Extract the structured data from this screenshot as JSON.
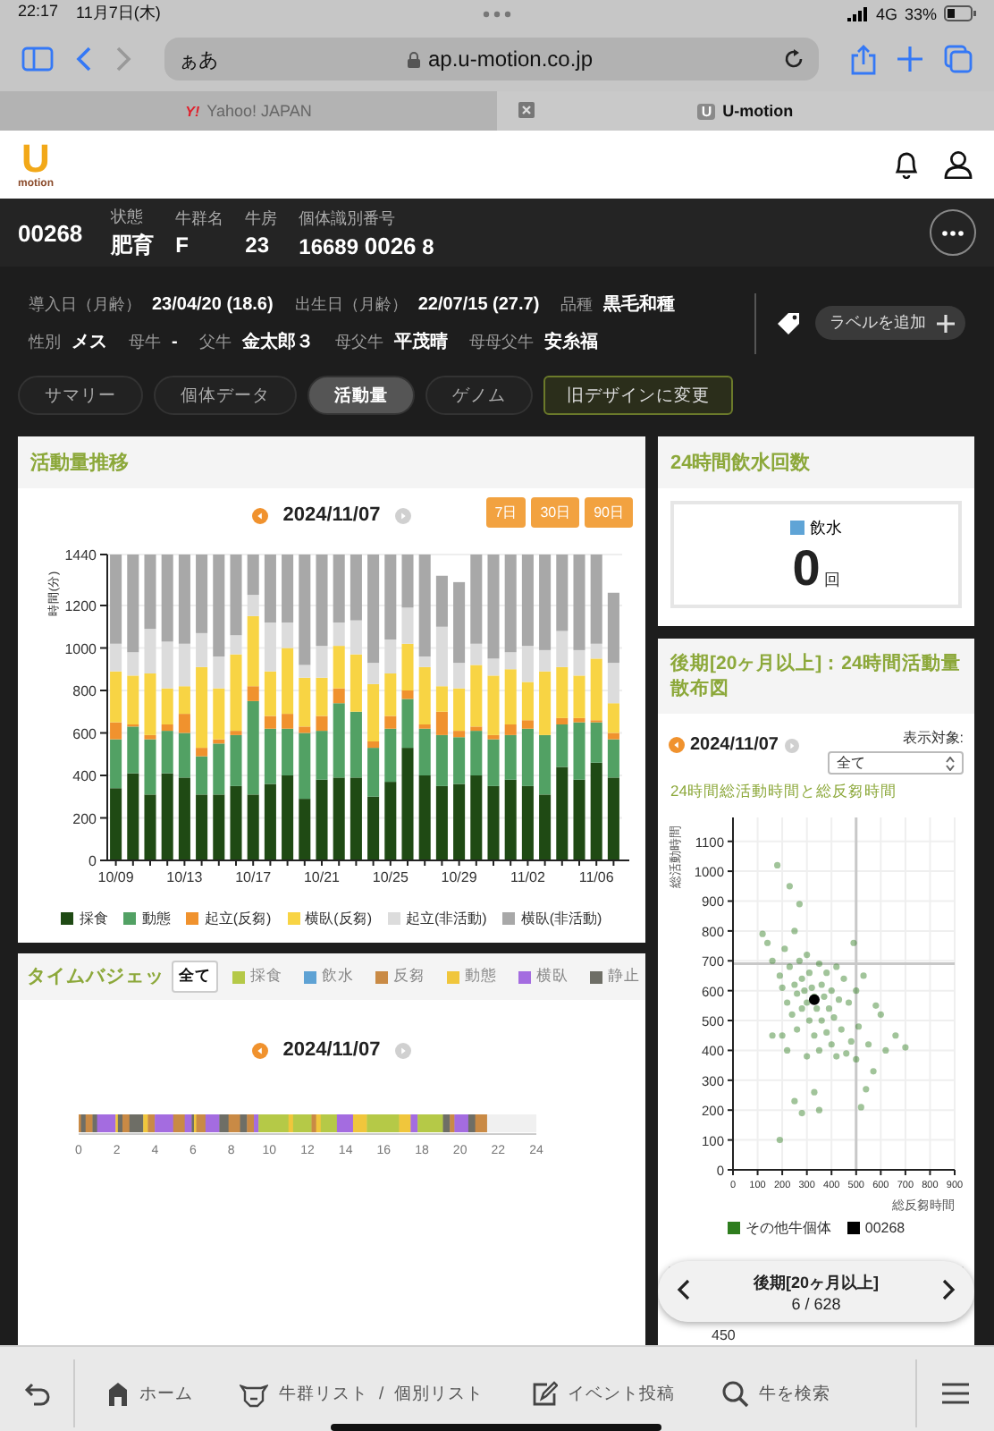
{
  "status_bar": {
    "time": "22:17",
    "date": "11月7日(木)",
    "network": "4G",
    "battery": "33%"
  },
  "browser": {
    "text_size": "ぁあ",
    "url": "ap.u-motion.co.jp",
    "tabs": [
      {
        "favicon": "Y!",
        "title": "Yahoo! JAPAN",
        "selected": false
      },
      {
        "favicon": "U",
        "title": "U-motion",
        "selected": true
      }
    ]
  },
  "logo": {
    "mark": "U",
    "name": "motion"
  },
  "animal": {
    "id": "00268",
    "fields": [
      {
        "label": "状態",
        "value": "肥育"
      },
      {
        "label": "牛群名",
        "value": "F"
      },
      {
        "label": "牛房",
        "value": "23"
      },
      {
        "label": "個体識別番号",
        "value": "16689 **0026** 8"
      }
    ]
  },
  "info_rows": [
    [
      {
        "label": "導入日（月齢）",
        "value": "23/04/20 (18.6)"
      },
      {
        "label": "出生日（月齢）",
        "value": "22/07/15 (27.7)"
      },
      {
        "label": "品種",
        "value": "黒毛和種"
      }
    ],
    [
      {
        "label": "性別",
        "value": "メス"
      },
      {
        "label": "母牛",
        "value": "-"
      },
      {
        "label": "父牛",
        "value": "金太郎３"
      },
      {
        "label": "母父牛",
        "value": "平茂晴"
      },
      {
        "label": "母母父牛",
        "value": "安糸福"
      }
    ]
  ],
  "add_label_button": "ラベルを追加",
  "tabs": [
    {
      "label": "サマリー",
      "selected": false
    },
    {
      "label": "個体データ",
      "selected": false
    },
    {
      "label": "活動量",
      "selected": true
    },
    {
      "label": "ゲノム",
      "selected": false
    }
  ],
  "old_design_button": "旧デザインに変更",
  "activity": {
    "title": "活動量推移",
    "date": "2024/11/07",
    "ranges": [
      "7日",
      "30日",
      "90日"
    ],
    "chart_data": {
      "type": "bar",
      "stacked": true,
      "ylabel": "時間(分)",
      "ylim": [
        0,
        1440
      ],
      "yticks": [
        0,
        200,
        400,
        600,
        800,
        1000,
        1200,
        1440
      ],
      "grid": true,
      "categories": [
        "10/09",
        null,
        null,
        null,
        "10/13",
        null,
        null,
        null,
        "10/17",
        null,
        null,
        null,
        "10/21",
        null,
        null,
        null,
        "10/25",
        null,
        null,
        null,
        "10/29",
        null,
        null,
        null,
        "11/02",
        null,
        null,
        null,
        "11/06",
        null
      ],
      "series": [
        {
          "name": "採食",
          "color": "#1f4a14",
          "values": [
            340,
            410,
            310,
            410,
            390,
            310,
            310,
            350,
            310,
            360,
            400,
            290,
            380,
            390,
            390,
            300,
            370,
            530,
            400,
            350,
            360,
            400,
            350,
            380,
            350,
            310,
            440,
            380,
            460,
            390
          ]
        },
        {
          "name": "動態",
          "color": "#52a164",
          "values": [
            230,
            220,
            260,
            200,
            210,
            180,
            240,
            240,
            440,
            260,
            220,
            310,
            230,
            350,
            310,
            230,
            250,
            230,
            220,
            240,
            220,
            210,
            220,
            210,
            270,
            280,
            200,
            270,
            190,
            180
          ]
        },
        {
          "name": "起立(反芻)",
          "color": "#f0922e",
          "values": [
            80,
            10,
            20,
            30,
            90,
            40,
            20,
            20,
            70,
            60,
            70,
            30,
            70,
            70,
            0,
            30,
            60,
            40,
            20,
            110,
            30,
            20,
            20,
            50,
            40,
            0,
            30,
            20,
            10,
            30
          ]
        },
        {
          "name": "横臥(反芻)",
          "color": "#f8d444",
          "values": [
            240,
            230,
            290,
            170,
            130,
            380,
            240,
            360,
            330,
            210,
            310,
            230,
            180,
            200,
            270,
            270,
            200,
            220,
            270,
            120,
            200,
            290,
            280,
            260,
            180,
            300,
            240,
            200,
            290,
            140
          ]
        },
        {
          "name": "起立(非活動)",
          "color": "#dcdcdc",
          "values": [
            130,
            110,
            210,
            220,
            200,
            160,
            150,
            90,
            100,
            230,
            120,
            60,
            150,
            110,
            160,
            100,
            160,
            170,
            50,
            280,
            120,
            100,
            80,
            80,
            170,
            100,
            170,
            120,
            70,
            190
          ]
        },
        {
          "name": "横臥(非活動)",
          "color": "#a8a8a8",
          "values": [
            420,
            460,
            350,
            410,
            420,
            370,
            480,
            380,
            190,
            320,
            320,
            520,
            430,
            320,
            310,
            510,
            400,
            250,
            480,
            240,
            380,
            420,
            490,
            460,
            430,
            450,
            360,
            450,
            420,
            330
          ]
        }
      ]
    }
  },
  "water": {
    "title": "24時間飲水回数",
    "legend": "飲水",
    "color": "#5fa4d6",
    "value": "0",
    "unit": "回"
  },
  "scatter": {
    "title": "後期[20ヶ月以上]：24時間活動量散布図",
    "date": "2024/11/07",
    "filter_label": "表示対象:",
    "filter_value": "全て",
    "subtitle": "24時間総活動時間と総反芻時間",
    "chart_data": {
      "type": "scatter",
      "xlabel": "総反芻時間",
      "ylabel": "総活動時間",
      "xlim": [
        0,
        900
      ],
      "ylim": [
        0,
        1180
      ],
      "xticks": [
        0,
        100,
        200,
        300,
        400,
        500,
        600,
        700,
        800,
        900
      ],
      "yticks": [
        0,
        100,
        200,
        300,
        400,
        500,
        600,
        700,
        800,
        900,
        1000,
        1100
      ],
      "grid": true,
      "ref_lines": [
        {
          "axis": "y",
          "value": 690
        },
        {
          "axis": "x",
          "value": 500
        }
      ],
      "series": [
        {
          "name": "その他牛個体",
          "color": "#2e7d1e",
          "x": [
            120,
            140,
            160,
            180,
            190,
            200,
            210,
            220,
            230,
            230,
            240,
            250,
            250,
            260,
            260,
            270,
            270,
            280,
            280,
            290,
            300,
            300,
            310,
            310,
            320,
            330,
            330,
            340,
            350,
            350,
            360,
            360,
            370,
            380,
            380,
            390,
            400,
            400,
            410,
            420,
            420,
            430,
            440,
            450,
            460,
            470,
            480,
            490,
            500,
            500,
            510,
            520,
            530,
            540,
            550,
            570,
            580,
            600,
            620,
            660,
            700,
            250,
            280,
            350,
            190,
            200,
            160,
            220,
            300,
            330
          ],
          "values": [
            790,
            760,
            700,
            1020,
            650,
            610,
            740,
            560,
            950,
            680,
            520,
            800,
            620,
            590,
            470,
            890,
            700,
            540,
            640,
            600,
            560,
            720,
            500,
            660,
            610,
            580,
            450,
            540,
            690,
            400,
            620,
            500,
            580,
            660,
            460,
            540,
            600,
            420,
            510,
            680,
            380,
            570,
            470,
            640,
            390,
            560,
            430,
            760,
            600,
            370,
            480,
            210,
            650,
            270,
            420,
            330,
            550,
            520,
            400,
            450,
            410,
            230,
            190,
            200,
            100,
            450,
            450,
            400,
            380,
            260
          ]
        },
        {
          "name": "00268",
          "color": "#000000",
          "x": [
            330
          ],
          "values": [
            570
          ]
        }
      ]
    },
    "pager": {
      "title": "後期[20ヶ月以上]",
      "count": "6 / 628"
    },
    "next_chart_tick": "450"
  },
  "time_budget": {
    "title": "タイムバジェッ",
    "date": "2024/11/07",
    "filters": [
      {
        "label": "全て",
        "kind": "all",
        "selected": true
      },
      {
        "label": "採食",
        "kind": "legend",
        "color": "#b5c947",
        "selected": false
      },
      {
        "label": "飲水",
        "kind": "legend",
        "color": "#5ea2d4",
        "selected": false
      },
      {
        "label": "反芻",
        "kind": "legend",
        "color": "#c98a45",
        "selected": false
      },
      {
        "label": "動態",
        "kind": "legend",
        "color": "#f0c63c",
        "selected": false
      },
      {
        "label": "横臥",
        "kind": "legend",
        "color": "#a46ce0",
        "selected": false
      },
      {
        "label": "静止",
        "kind": "legend",
        "color": "#6e6e66",
        "selected": false
      }
    ],
    "axis_labels": [
      "0",
      "2",
      "4",
      "6",
      "8",
      "10",
      "12",
      "14",
      "16",
      "18",
      "20",
      "22",
      "24"
    ]
  },
  "bottom_nav": [
    {
      "kind": "back"
    },
    {
      "kind": "home",
      "labels": [
        "ホーム"
      ]
    },
    {
      "kind": "herd",
      "labels": [
        "牛群リスト",
        "/",
        "個別リスト"
      ]
    },
    {
      "kind": "event",
      "labels": [
        "イベント投稿"
      ]
    },
    {
      "kind": "search",
      "labels": [
        "牛を検索"
      ]
    },
    {
      "kind": "menu"
    }
  ]
}
